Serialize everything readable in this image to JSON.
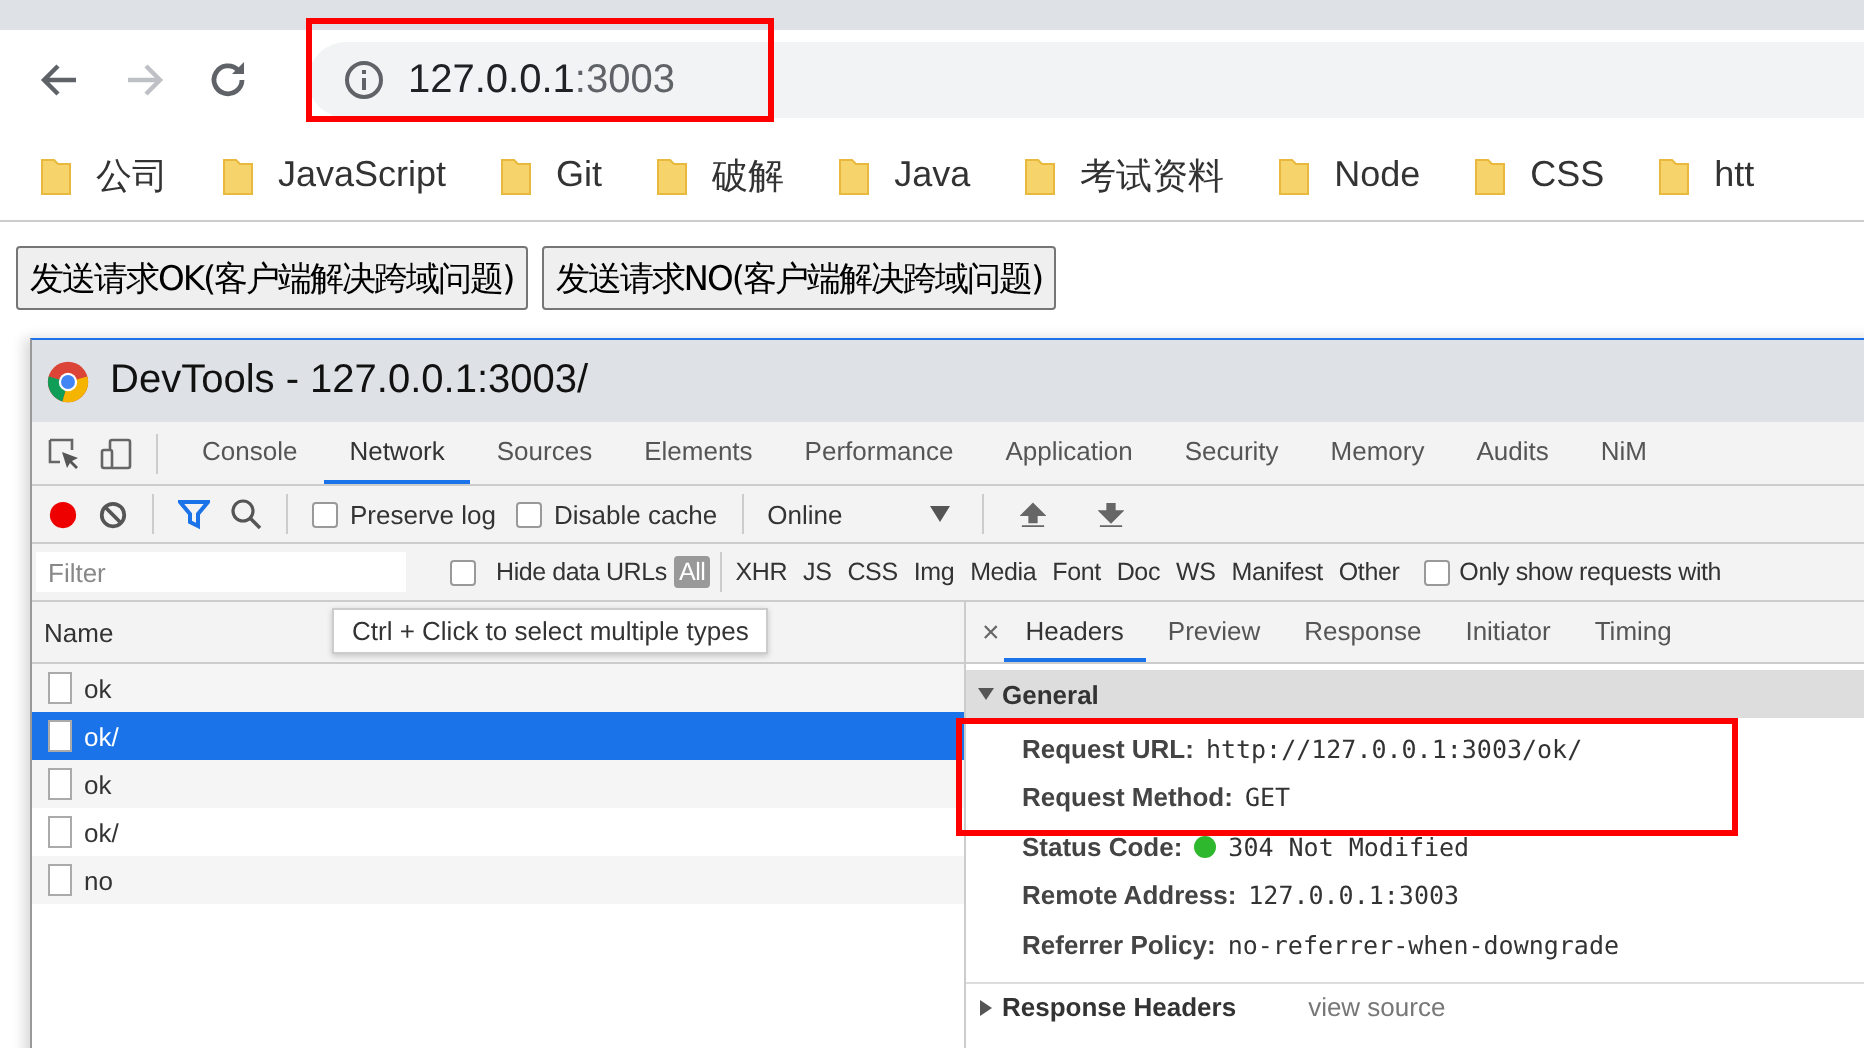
{
  "browser": {
    "nav": {
      "forward_disabled": true
    },
    "address": {
      "host": "127.0.0.1",
      "port": ":3003"
    },
    "bookmarks": [
      "公司",
      "JavaScript",
      "Git",
      "破解",
      "Java",
      "考试资料",
      "Node",
      "CSS",
      "htt"
    ]
  },
  "page": {
    "buttons": [
      "发送请求OK(客户端解决跨域问题)",
      "发送请求NO(客户端解决跨域问题)"
    ]
  },
  "devtools": {
    "title": "DevTools - 127.0.0.1:3003/",
    "tabs": [
      {
        "label": "Console",
        "selected": false
      },
      {
        "label": "Network",
        "selected": true
      },
      {
        "label": "Sources",
        "selected": false
      },
      {
        "label": "Elements",
        "selected": false
      },
      {
        "label": "Performance",
        "selected": false
      },
      {
        "label": "Application",
        "selected": false
      },
      {
        "label": "Security",
        "selected": false
      },
      {
        "label": "Memory",
        "selected": false
      },
      {
        "label": "Audits",
        "selected": false
      },
      {
        "label": "NiM",
        "selected": false
      }
    ],
    "toolbar": {
      "recording": true,
      "filter_on": true,
      "preserve_log": {
        "label": "Preserve log",
        "checked": false
      },
      "disable_cache": {
        "label": "Disable cache",
        "checked": false
      },
      "throttling": "Online"
    },
    "filter": {
      "placeholder": "Filter",
      "hide_data_urls": {
        "label": "Hide data URLs",
        "checked": false
      },
      "types": [
        {
          "label": "All",
          "selected": true
        },
        {
          "label": "XHR",
          "selected": false
        },
        {
          "label": "JS",
          "selected": false
        },
        {
          "label": "CSS",
          "selected": false
        },
        {
          "label": "Img",
          "selected": false
        },
        {
          "label": "Media",
          "selected": false
        },
        {
          "label": "Font",
          "selected": false
        },
        {
          "label": "Doc",
          "selected": false
        },
        {
          "label": "WS",
          "selected": false
        },
        {
          "label": "Manifest",
          "selected": false
        },
        {
          "label": "Other",
          "selected": false
        }
      ],
      "only_show": {
        "label": "Only show requests with",
        "checked": false
      }
    },
    "tooltip": "Ctrl + Click to select multiple types",
    "requests": {
      "column": "Name",
      "rows": [
        {
          "name": "ok",
          "selected": false
        },
        {
          "name": "ok/",
          "selected": true
        },
        {
          "name": "ok",
          "selected": false
        },
        {
          "name": "ok/",
          "selected": false
        },
        {
          "name": "no",
          "selected": false
        }
      ]
    },
    "detail": {
      "close": "×",
      "tabs": [
        {
          "label": "Headers",
          "selected": true
        },
        {
          "label": "Preview",
          "selected": false
        },
        {
          "label": "Response",
          "selected": false
        },
        {
          "label": "Initiator",
          "selected": false
        },
        {
          "label": "Timing",
          "selected": false
        }
      ],
      "general": {
        "title": "General",
        "expanded": true,
        "fields": [
          {
            "label": "Request URL:",
            "value": "http://127.0.0.1:3003/ok/"
          },
          {
            "label": "Request Method:",
            "value": "GET"
          },
          {
            "label": "Status Code:",
            "value": "304 Not Modified",
            "color": "#2eb82e"
          },
          {
            "label": "Remote Address:",
            "value": "127.0.0.1:3003"
          },
          {
            "label": "Referrer Policy:",
            "value": "no-referrer-when-downgrade"
          }
        ]
      },
      "response_headers": {
        "title": "Response Headers",
        "expanded": false,
        "action": "view source"
      }
    }
  }
}
